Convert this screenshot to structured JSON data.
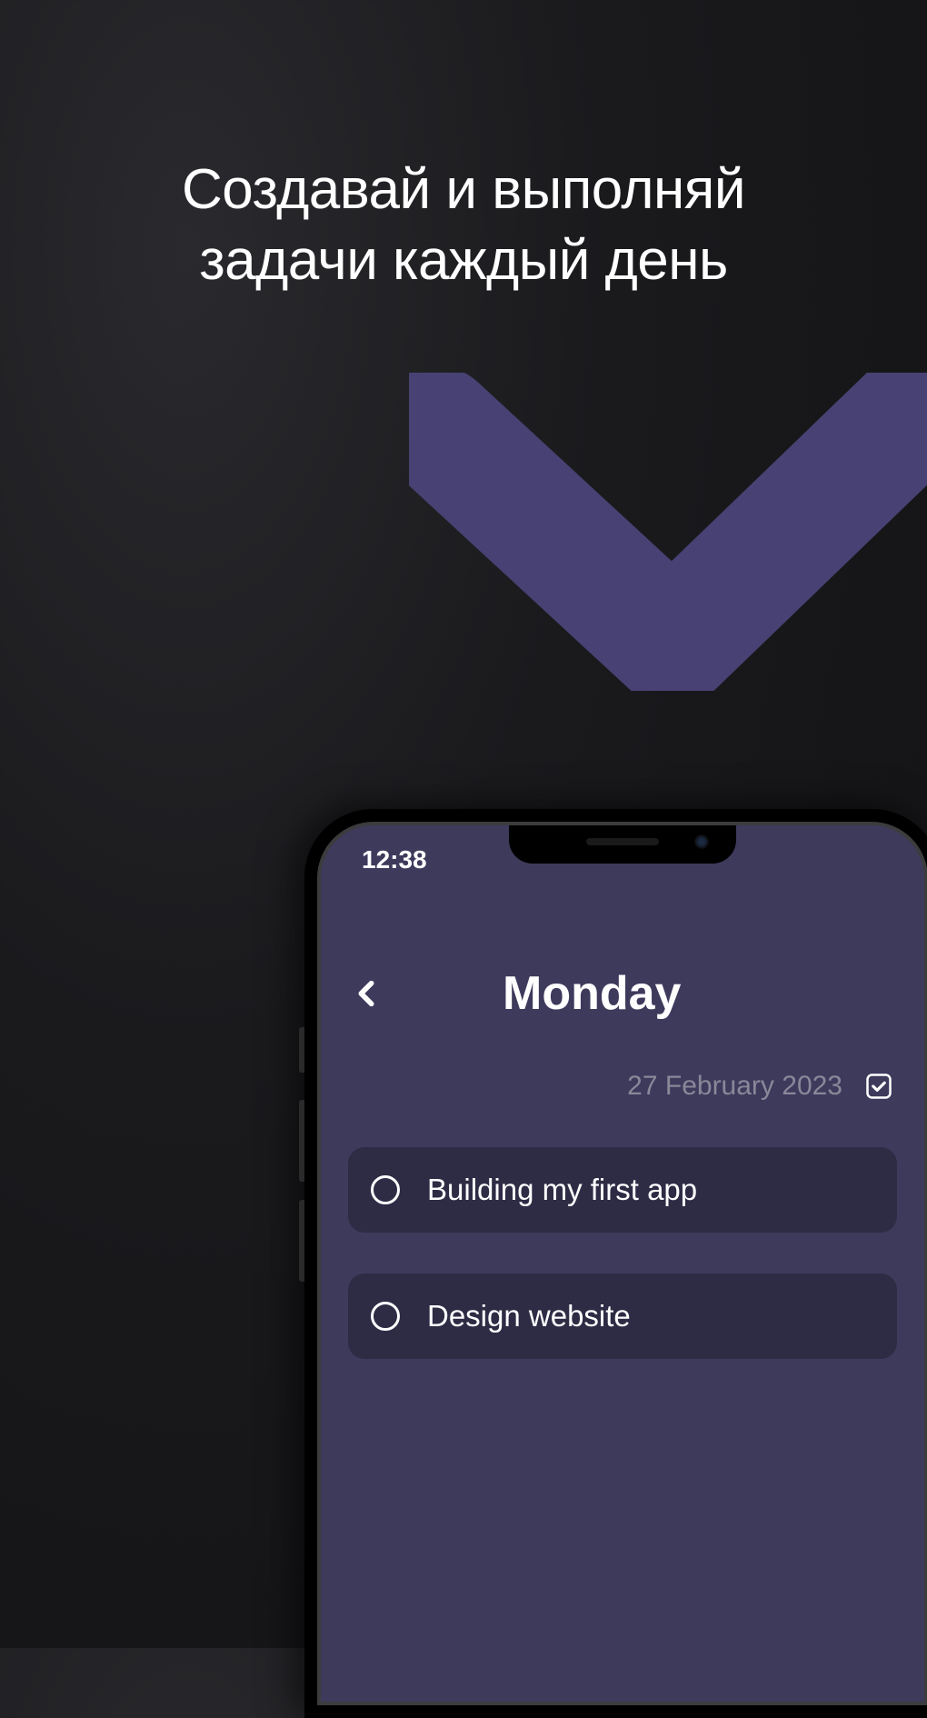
{
  "headline": {
    "line1": "Создавай и выполняй",
    "line2": "задачи каждый день"
  },
  "colors": {
    "accent": "#474273",
    "phone_bg": "#3e3a5c",
    "task_bg": "#2e2b45",
    "muted_text": "#8a8799"
  },
  "status_bar": {
    "time": "12:38"
  },
  "app": {
    "day_title": "Monday",
    "date": "27 February 2023",
    "tasks": [
      {
        "label": "Building my first app",
        "done": false
      },
      {
        "label": "Design website",
        "done": false
      }
    ]
  }
}
